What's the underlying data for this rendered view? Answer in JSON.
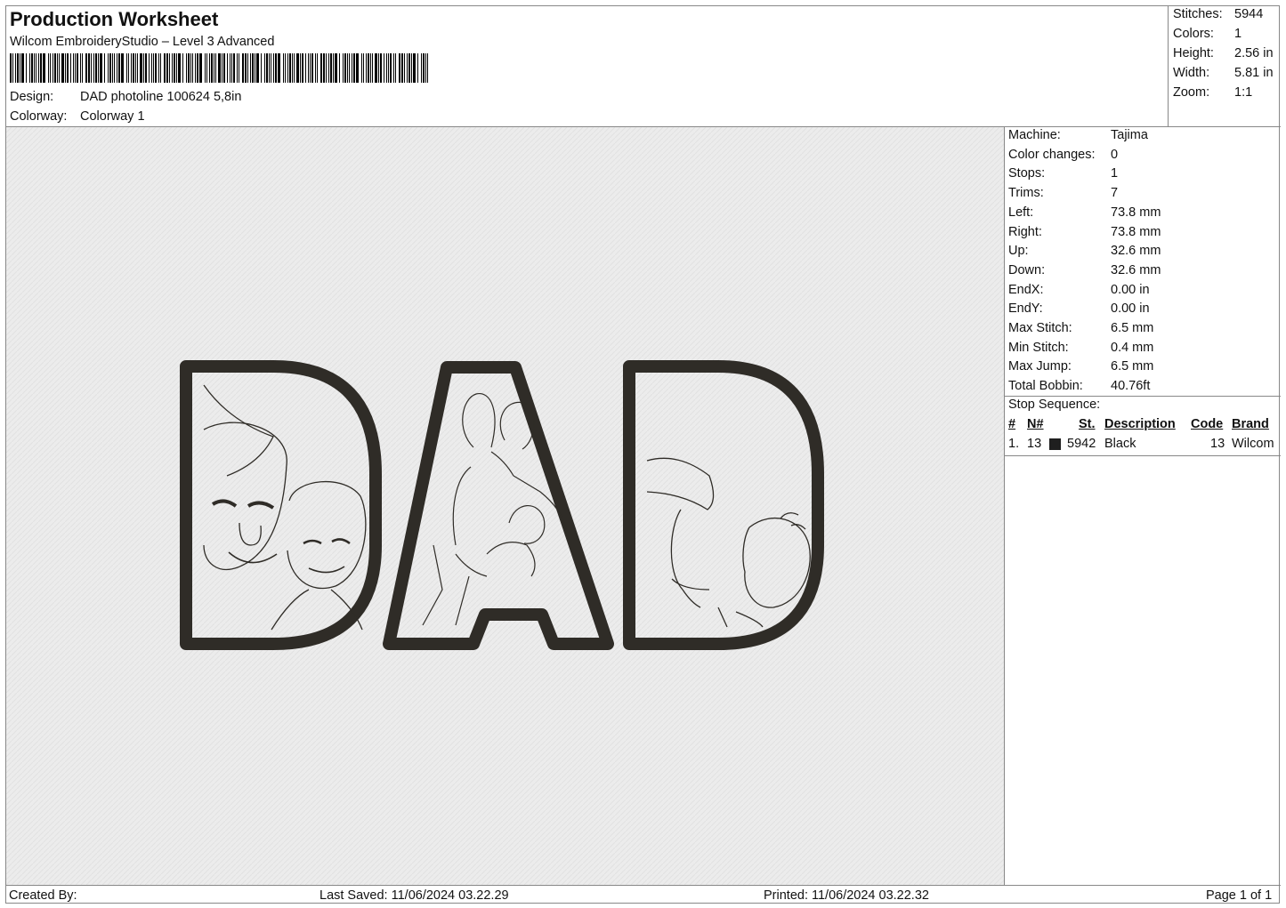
{
  "header": {
    "title": "Production Worksheet",
    "software": "Wilcom EmbroideryStudio – Level 3 Advanced",
    "barcode_label": "barcode",
    "design_label": "Design:",
    "design_value": "DAD photoline 100624 5,8in",
    "colorway_label": "Colorway:",
    "colorway_value": "Colorway 1"
  },
  "stats": [
    {
      "label": "Stitches:",
      "value": "5944"
    },
    {
      "label": "Colors:",
      "value": "1"
    },
    {
      "label": "Height:",
      "value": "2.56 in"
    },
    {
      "label": "Width:",
      "value": "5.81 in"
    },
    {
      "label": "Zoom:",
      "value": "1:1"
    }
  ],
  "machine_info": [
    {
      "label": "Machine:",
      "value": "Tajima"
    },
    {
      "label": "Color changes:",
      "value": "0"
    },
    {
      "label": "Stops:",
      "value": "1"
    },
    {
      "label": "Trims:",
      "value": "7"
    },
    {
      "label": "Left:",
      "value": "73.8 mm"
    },
    {
      "label": "Right:",
      "value": "73.8 mm"
    },
    {
      "label": "Up:",
      "value": "32.6 mm"
    },
    {
      "label": "Down:",
      "value": "32.6 mm"
    },
    {
      "label": "EndX:",
      "value": "0.00 in"
    },
    {
      "label": "EndY:",
      "value": "0.00 in"
    },
    {
      "label": "Max Stitch:",
      "value": "6.5 mm"
    },
    {
      "label": "Min Stitch:",
      "value": "0.4 mm"
    },
    {
      "label": "Max Jump:",
      "value": "6.5 mm"
    },
    {
      "label": "Total Bobbin:",
      "value": "40.76ft"
    }
  ],
  "stop_sequence": {
    "title": "Stop Sequence:",
    "columns": [
      "#",
      "N#",
      "St.",
      "Description",
      "Code",
      "Brand"
    ],
    "rows": [
      {
        "num": "1.",
        "n": "13",
        "swatch_color": "#1f1f1f",
        "stitches": "5942",
        "description": "Black",
        "code": "13",
        "brand": "Wilcom"
      }
    ]
  },
  "footer": {
    "created_by": "Created By:",
    "last_saved": "Last Saved: 11/06/2024 03.22.29",
    "printed": "Printed: 11/06/2024 03.22.32",
    "page": "Page 1 of 1"
  },
  "design_preview": {
    "thread_color": "#2f2c27",
    "fabric_color": "#ececec"
  }
}
